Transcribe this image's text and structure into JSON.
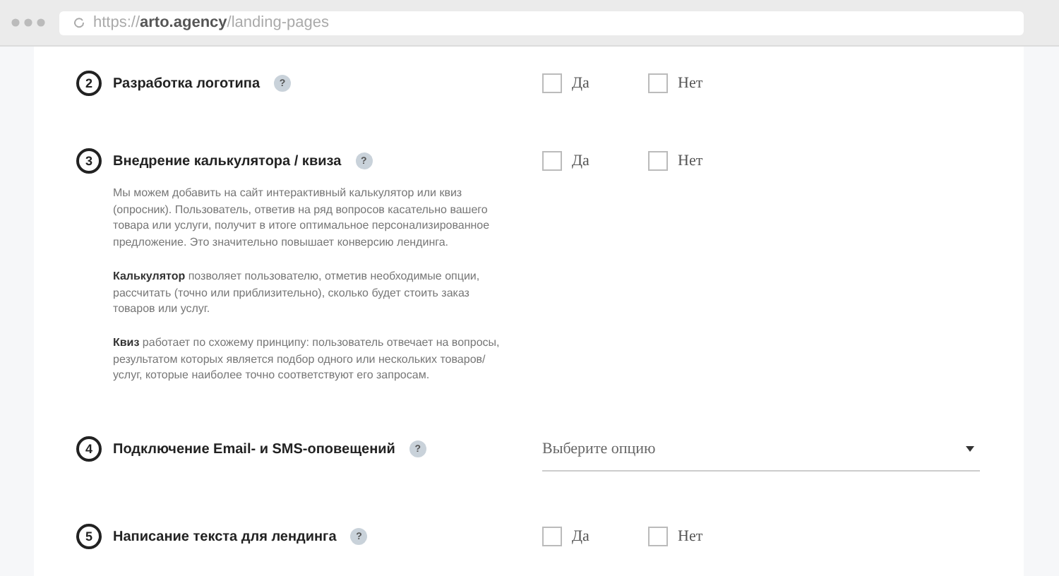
{
  "browser": {
    "url": "https://**arto.agency**/landing-pages"
  },
  "items": [
    {
      "number": "2",
      "title": "Разработка логотипа",
      "help": "?",
      "kind": "yesno",
      "options": [
        {
          "label": "Да",
          "checked": false
        },
        {
          "label": "Нет",
          "checked": false
        }
      ]
    },
    {
      "number": "3",
      "title": "Внедрение калькулятора / квиза",
      "help": "?",
      "kind": "yesno",
      "options": [
        {
          "label": "Да",
          "checked": false
        },
        {
          "label": "Нет",
          "checked": false
        }
      ],
      "description": [
        "Мы можем добавить на сайт интерактивный калькулятор или квиз (опросник). Пользователь, ответив на ряд вопросов касательно вашего товара или услуги, получит в итоге оптимальное персонализированное предложение. Это значительно повышает конверсию лендинга.",
        "**Калькулятор** позволяет пользователю, отметив необходимые опции, рассчитать (точно или приблизительно), сколько будет стоить заказ товаров или услуг.",
        "**Квиз** работает по схожему принципу: пользователь отвечает на вопросы, результатом которых является подбор одного или нескольких товаров/услуг, которые наиболее точно соответствуют его запросам."
      ]
    },
    {
      "number": "4",
      "title": "Подключение Email- и SMS-оповещений",
      "help": "?",
      "kind": "select",
      "placeholder": "Выберите опцию"
    },
    {
      "number": "5",
      "title": "Написание текста для лендинга",
      "help": "?",
      "kind": "yesno",
      "options": [
        {
          "label": "Да",
          "checked": false
        },
        {
          "label": "Нет",
          "checked": false
        }
      ]
    }
  ]
}
